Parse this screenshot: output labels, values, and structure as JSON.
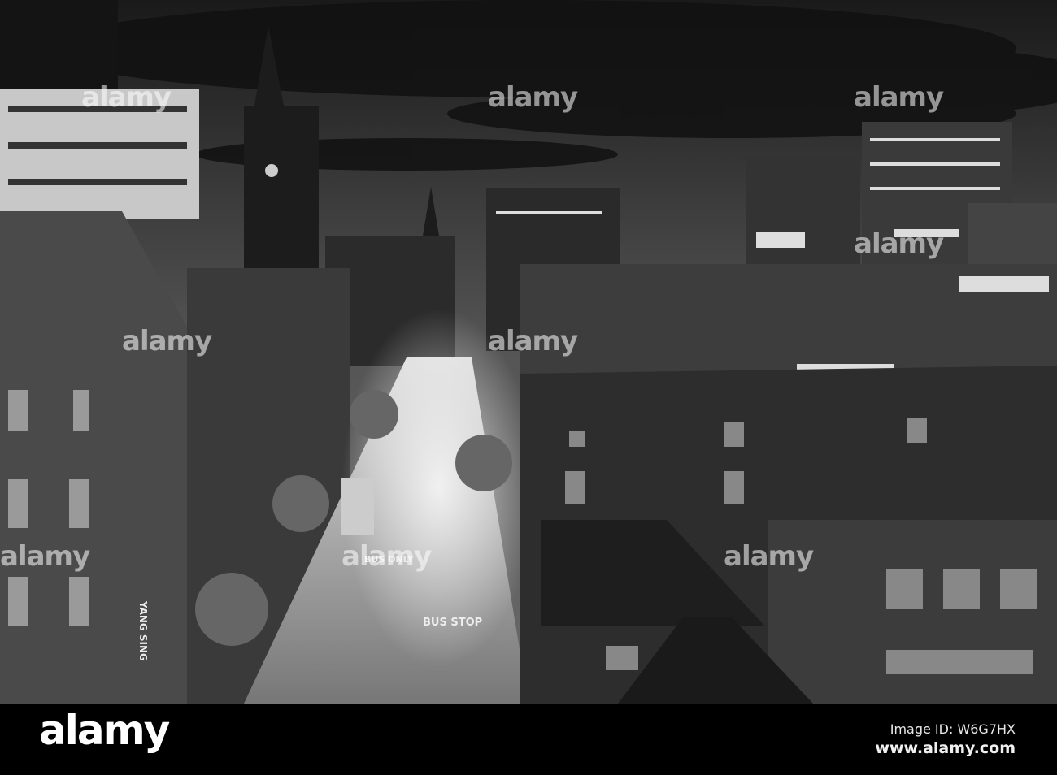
{
  "photo": {
    "description_alt": "Black and white night view of a city street",
    "street_markings": [
      "BUS STOP",
      "BUS ONLY",
      "BUS"
    ],
    "shop_sign": "YANG SING"
  },
  "watermark": "alamy",
  "footer": {
    "logo": "alamy",
    "image_id": "Image ID: W6G7HX",
    "website": "www.alamy.com"
  }
}
